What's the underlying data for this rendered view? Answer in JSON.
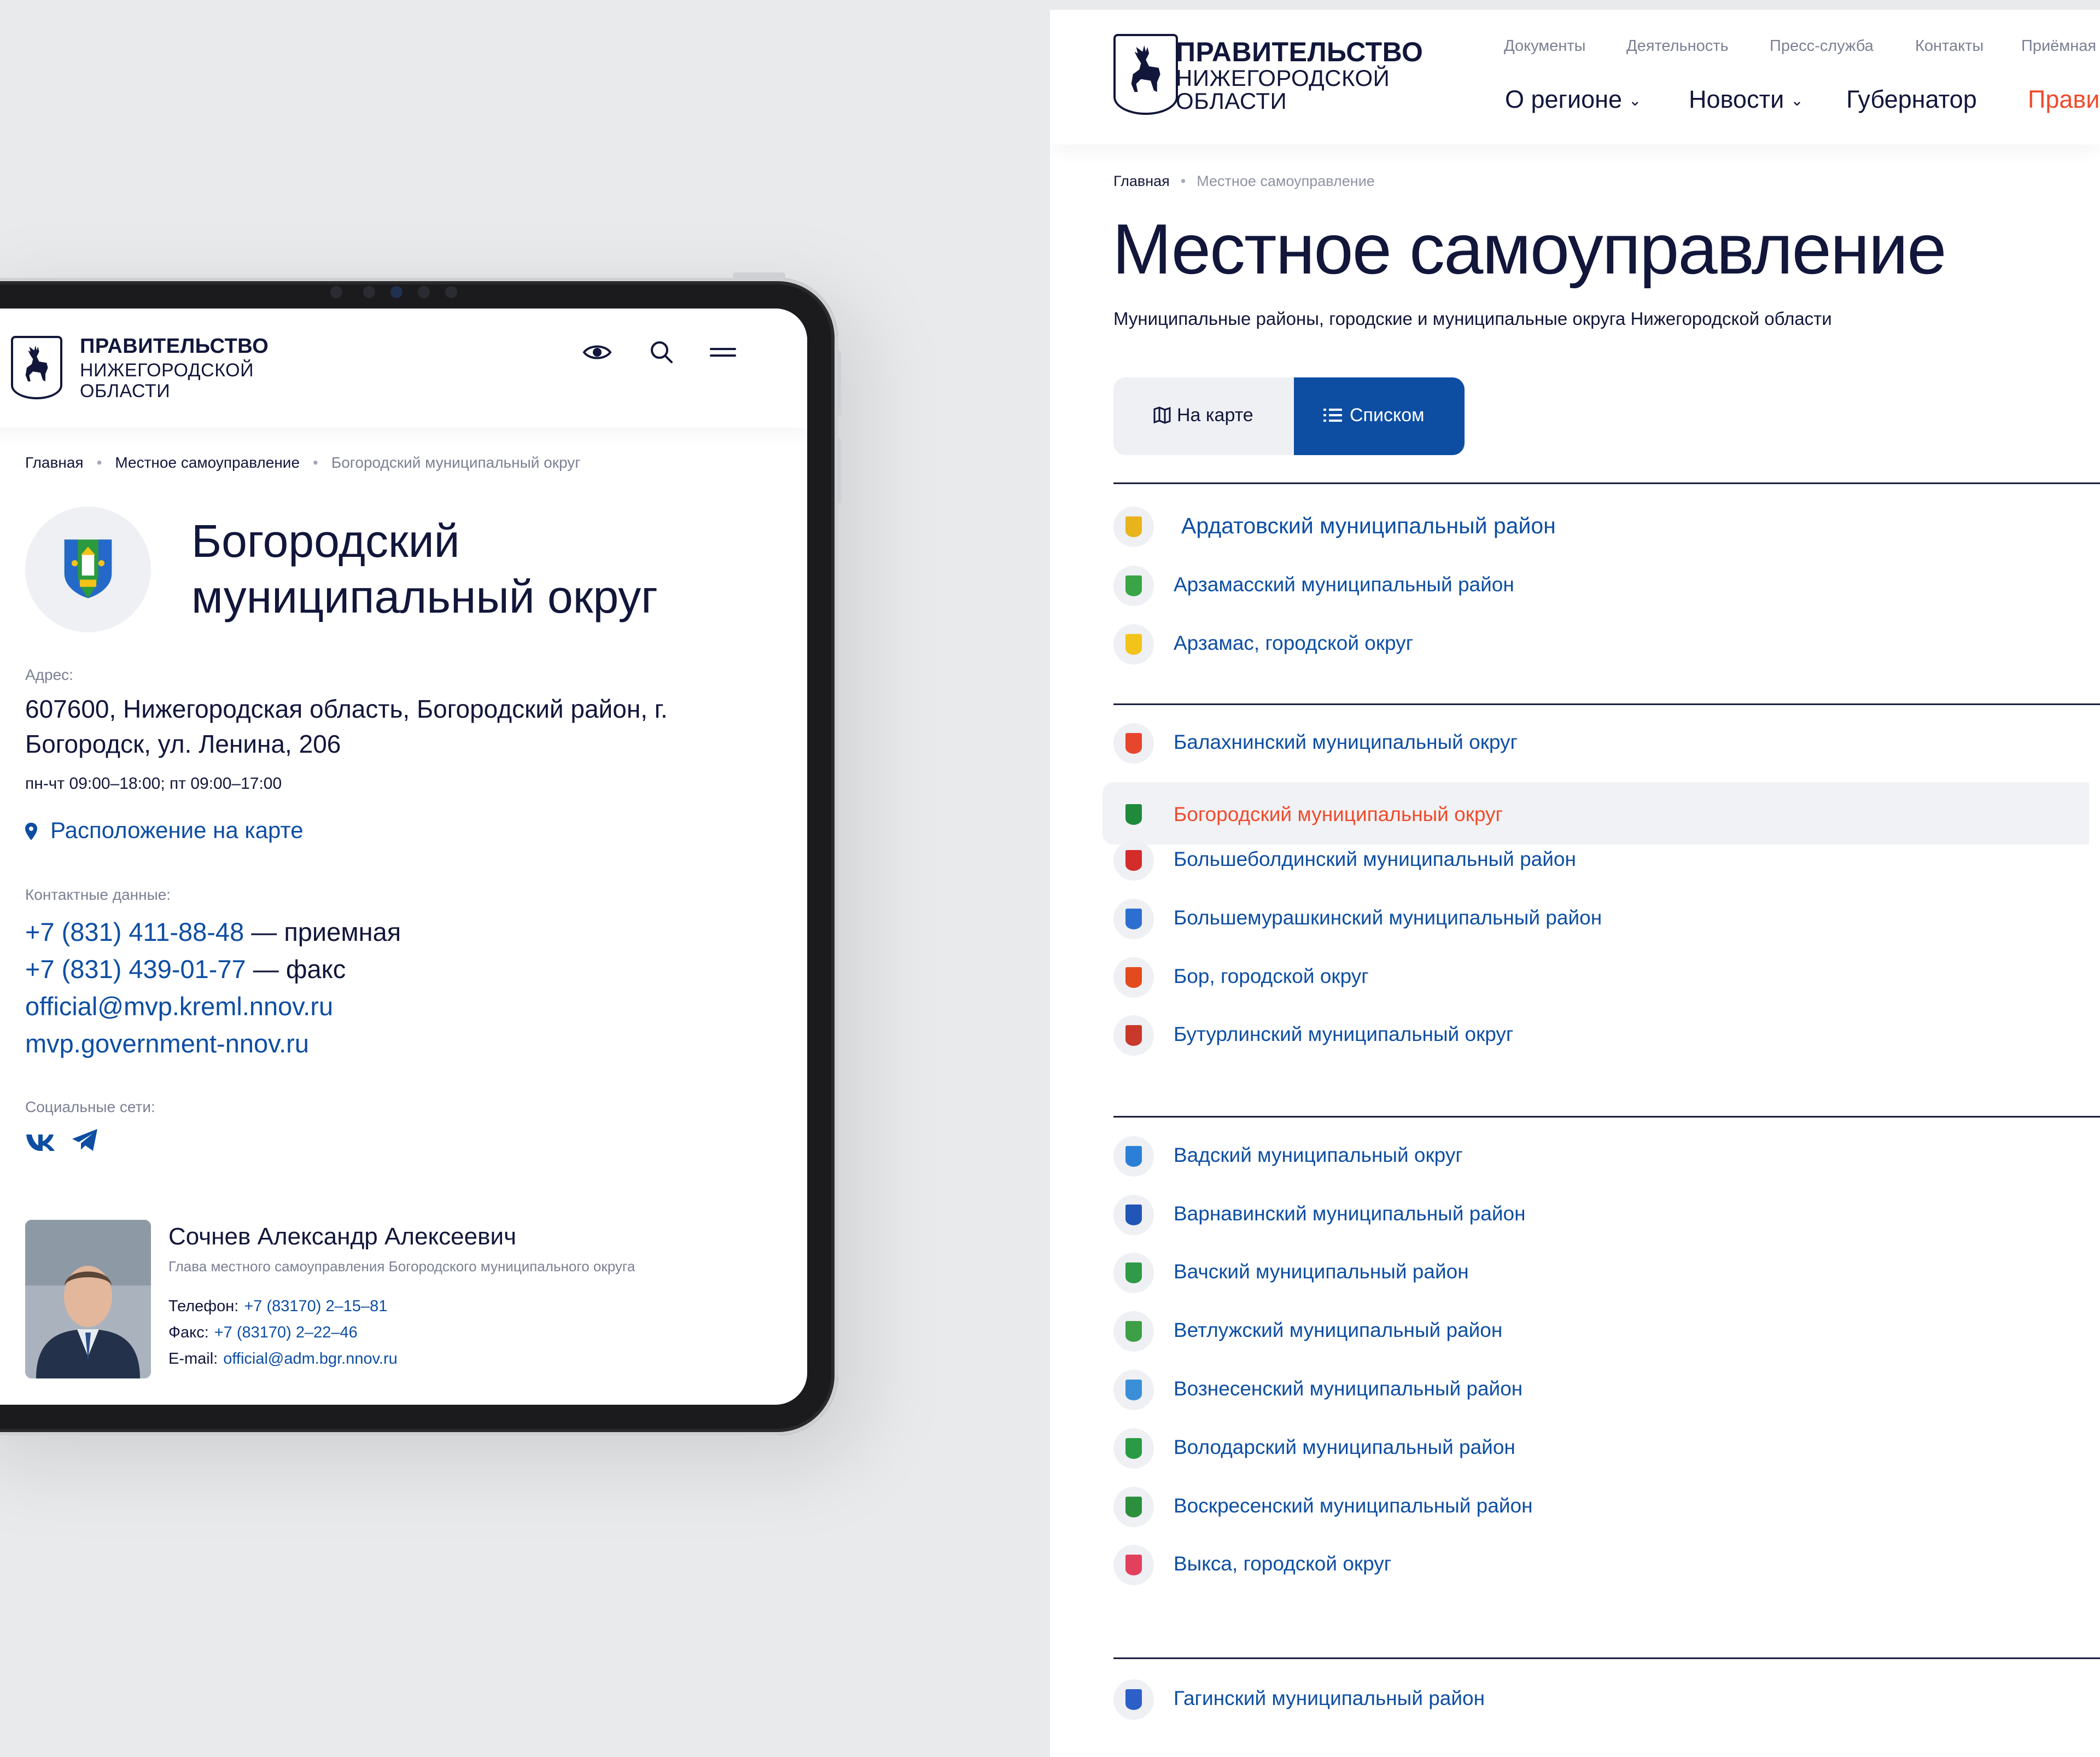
{
  "brand": {
    "line1": "ПРАВИТЕЛЬСТВО",
    "line2": "НИЖЕГОРОДСКОЙ",
    "line3": "ОБЛАСТИ"
  },
  "colors": {
    "accent": "#0d4ea3",
    "active": "#f04b2c",
    "text": "#11163a",
    "muted": "#7b8093"
  },
  "tablet": {
    "icons": [
      "eye-icon",
      "search-icon",
      "menu-icon"
    ],
    "breadcrumbs": [
      "Главная",
      "Местное самоуправление",
      "Богородский муниципальный округ"
    ],
    "title": "Богородский муниципальный округ",
    "address_label": "Адрес:",
    "address": "607600, Нижегородская область, Богородский район, г. Богородск, ул. Ленина, 206",
    "hours": "пн-чт 09:00–18:00; пт 09:00–17:00",
    "map_link": "Расположение на карте",
    "contacts_label": "Контактные данные:",
    "phone1": "+7 (831) 411-88-48",
    "phone1_note": "— приемная",
    "phone2": "+7 (831) 439-01-77",
    "phone2_note": "— факс",
    "email": "official@mvp.kreml.nnov.ru",
    "site": "mvp.government-nnov.ru",
    "social_label": "Социальные сети:",
    "social": [
      "vk-icon",
      "telegram-icon"
    ],
    "head": {
      "name": "Сочнев Александр Алексеевич",
      "role": "Глава местного самоуправления Богородского муниципального округа",
      "phone_label": "Телефон:",
      "phone": "+7 (83170) 2–15–81",
      "fax_label": "Факс:",
      "fax": "+7 (83170) 2–22–46",
      "email_label": "E-mail:",
      "email": "official@adm.bgr.nnov.ru"
    }
  },
  "desktop": {
    "top_nav": [
      "Документы",
      "Деятельность",
      "Пресс-служба",
      "Контакты",
      "Приёмная"
    ],
    "main_nav": [
      {
        "label": "О регионе",
        "dropdown": true
      },
      {
        "label": "Новости",
        "dropdown": true
      },
      {
        "label": "Губернатор",
        "dropdown": false
      },
      {
        "label": "Прави",
        "dropdown": false
      }
    ],
    "breadcrumbs": [
      "Главная",
      "Местное самоуправление"
    ],
    "title": "Местное самоуправление",
    "subtitle": "Муниципальные районы, городские и муниципальные округа Нижегородской области",
    "view_map": "На карте",
    "view_list": "Списком",
    "active_view": "list",
    "groups": [
      {
        "items": [
          {
            "name": "Ардатовский муниципальный район",
            "color": "#e8b41c"
          },
          {
            "name": "Арзамасский муниципальный район",
            "color": "#3aa546"
          },
          {
            "name": "Арзамас, городской округ",
            "color": "#f2c319"
          }
        ]
      },
      {
        "items": [
          {
            "name": "Балахнинский муниципальный округ",
            "color": "#e8452e"
          },
          {
            "name": "Богородский муниципальный округ",
            "color": "#1f8a3c",
            "active": true
          },
          {
            "name": "Большеболдинский муниципальный район",
            "color": "#d42b2b"
          },
          {
            "name": "Большемурашкинский муниципальный район",
            "color": "#2d6fd0"
          },
          {
            "name": "Бор, городской округ",
            "color": "#e34b1e"
          },
          {
            "name": "Бутурлинский муниципальный округ",
            "color": "#c8392b"
          }
        ]
      },
      {
        "items": [
          {
            "name": "Вадский муниципальный округ",
            "color": "#2b7fd6"
          },
          {
            "name": "Варнавинский муниципальный район",
            "color": "#2256b6"
          },
          {
            "name": "Вачский муниципальный район",
            "color": "#2f9a48"
          },
          {
            "name": "Ветлужский муниципальный район",
            "color": "#3d9f46"
          },
          {
            "name": "Вознесенский муниципальный район",
            "color": "#3b8fd8"
          },
          {
            "name": "Володарский муниципальный район",
            "color": "#2a9b44"
          },
          {
            "name": "Воскресенский муниципальный район",
            "color": "#2c8f3e"
          },
          {
            "name": "Выкса, городской округ",
            "color": "#e2405c"
          }
        ]
      },
      {
        "items": [
          {
            "name": "Гагинский муниципальный район",
            "color": "#2d5fc8"
          }
        ]
      }
    ]
  }
}
